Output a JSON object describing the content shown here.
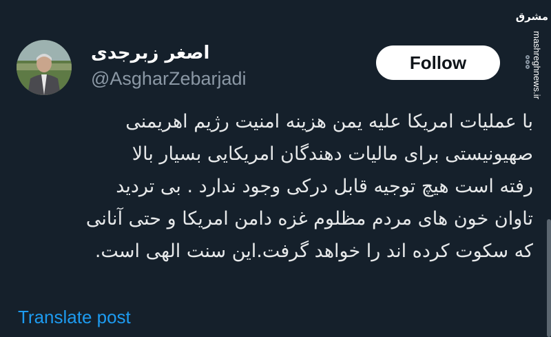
{
  "author": {
    "display_name": "اصغر زبرجدی",
    "handle": "@AsgharZebarjadi"
  },
  "follow_button": {
    "label": "Follow"
  },
  "tweet": {
    "lines": [
      "با عملیات امریکا علیه یمن  هزینه امنیت رژیم اهریمنی",
      "صهیونیستی برای مالیات دهندگان امریکایی بسیار بالا",
      "رفته است هیچ توجیه قابل درکی وجود ندارد . بی تردید",
      "تاوان خون های مردم مظلوم غزه دامن امریکا و حتی آنانی",
      "که سکوت کرده اند را خواهد گرفت.این سنت الهی است."
    ]
  },
  "translate": {
    "label": "Translate post"
  },
  "watermark": {
    "logo": "مشرق",
    "site": "mashreghnews.ir"
  },
  "icons": {
    "more": "more-vertical-icon",
    "avatar": "profile-photo"
  },
  "colors": {
    "background": "#15202b",
    "text": "#e7e9ea",
    "secondary": "#8b98a5",
    "link": "#1d9bf0",
    "button_bg": "#ffffff"
  }
}
